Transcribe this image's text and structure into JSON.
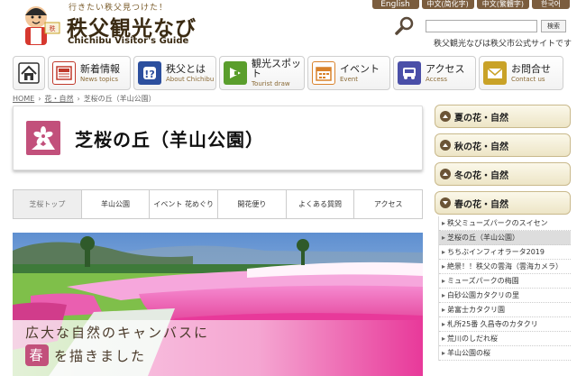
{
  "header": {
    "tagline": "行きたい秩父見つけた！",
    "title": "秩父観光なび",
    "subtitle": "Chichibu Visitor's Guide",
    "languages": [
      "English",
      "中文(简化字)",
      "中文(繁體字)",
      "한국어"
    ],
    "search_button": "検索",
    "site_note": "秩父観光なびは秩父市公式サイトです"
  },
  "nav": {
    "items": [
      {
        "jp": "新着情報",
        "en": "News topics",
        "icon": "news-icon",
        "color": "#c0392b"
      },
      {
        "jp": "秩父とは",
        "en": "About Chichibu",
        "icon": "info-icon",
        "color": "#2c4f9e"
      },
      {
        "jp": "観光スポット",
        "en": "Tourist draw",
        "icon": "spot-icon",
        "color": "#5a9e2c"
      },
      {
        "jp": "イベント",
        "en": "Event",
        "icon": "calendar-icon",
        "color": "#d9822b"
      },
      {
        "jp": "アクセス",
        "en": "Access",
        "icon": "car-icon",
        "color": "#4a4fa8"
      },
      {
        "jp": "お問合せ",
        "en": "Contact us",
        "icon": "mail-icon",
        "color": "#c9a227"
      }
    ]
  },
  "breadcrumb": [
    "HOME",
    "花・自然",
    "芝桜の丘（羊山公園）"
  ],
  "page": {
    "title": "芝桜の丘（羊山公園）"
  },
  "subtabs": [
    "芝桜トップ",
    "羊山公園",
    "イベント 花めぐり",
    "開花便り",
    "よくある質問",
    "アクセス"
  ],
  "hero": {
    "caption_line1": "広大な自然のキャンバスに",
    "caption_badge": "春",
    "caption_line2": "を描きました"
  },
  "sidebar": {
    "sections": [
      "夏の花・自然",
      "秋の花・自然",
      "冬の花・自然",
      "春の花・自然"
    ],
    "spring_items": [
      "秩父ミューズパークのスイセン",
      "芝桜の丘（羊山公園）",
      "ちちぶインフィオラータ2019",
      "絶景！！秩父の雲海（雲海カメラ）",
      "ミューズパークの梅園",
      "白砂公園カタクリの里",
      "弟富士カタクリ園",
      "札所25番 久昌寺のカタクリ",
      "荒川のしだれ桜",
      "羊山公園の桜"
    ]
  },
  "colors": {
    "brand_brown": "#7b5d3e",
    "accent_pink": "#c2507b"
  }
}
